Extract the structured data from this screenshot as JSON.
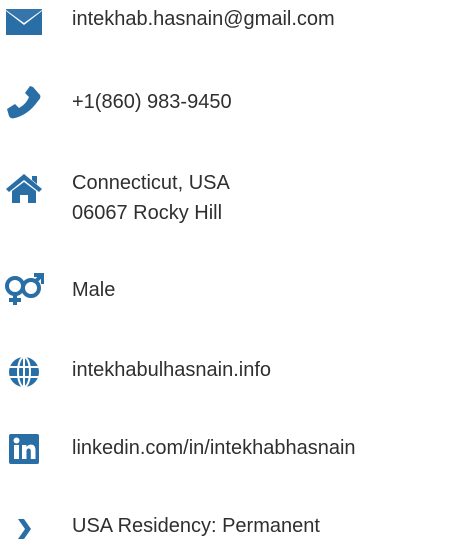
{
  "accent_color": "#2a6ea6",
  "contacts": [
    {
      "icon": "envelope-icon",
      "text": "intekhab.hasnain@gmail.com"
    },
    {
      "icon": "phone-icon",
      "text": "+1(860) 983-9450"
    },
    {
      "icon": "home-icon",
      "lines": [
        "Connecticut, USA",
        "06067 Rocky Hill"
      ]
    },
    {
      "icon": "gender-icon",
      "text": "Male"
    },
    {
      "icon": "globe-icon",
      "text": "intekhabulhasnain.info"
    },
    {
      "icon": "linkedin-icon",
      "text": "linkedin.com/in/intekhabhasnain"
    },
    {
      "icon": "chevron-right-icon",
      "text": "USA Residency: Permanent"
    }
  ]
}
